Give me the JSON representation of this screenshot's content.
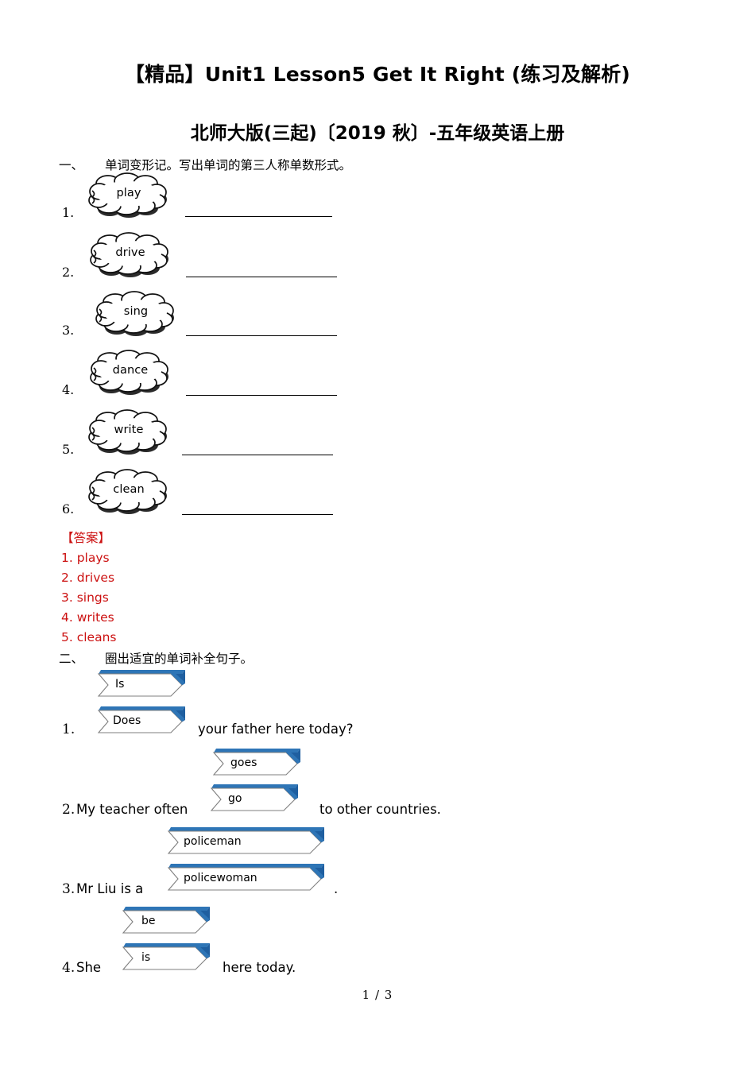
{
  "document": {
    "title_main": "【精品】Unit1 Lesson5 Get It Right (练习及解析)",
    "title_sub": "北师大版(三起)〔2019 秋〕-五年级英语上册",
    "footer": "1 / 3"
  },
  "colors": {
    "answer_red": "#CC1111",
    "chevron_blue": "#2E75B6",
    "chevron_outline": "#7F7F7F",
    "text_black": "#000000"
  },
  "section_one": {
    "marker": "一、",
    "heading": "单词变形记。写出单词的第三人称单数形式。",
    "items": [
      {
        "number": "1.",
        "word": "play",
        "blank": ""
      },
      {
        "number": "2.",
        "word": "drive",
        "blank": ""
      },
      {
        "number": "3.",
        "word": "sing",
        "blank": ""
      },
      {
        "number": "4.",
        "word": "dance",
        "blank": ""
      },
      {
        "number": "5.",
        "word": "write",
        "blank": ""
      },
      {
        "number": "6.",
        "word": "clean",
        "blank": ""
      }
    ]
  },
  "answer_block": {
    "label": "【答案】",
    "lines": [
      "1. plays",
      "2. drives",
      "3. sings",
      "4. writes",
      "5. cleans"
    ]
  },
  "section_two": {
    "marker": "二、",
    "heading": "圈出适宜的单词补全句子。",
    "questions": [
      {
        "number": "1.",
        "options": [
          "Is",
          "Does"
        ],
        "text_before": "",
        "text_after": "your father here today?"
      },
      {
        "number": "2.",
        "options": [
          "goes",
          "go"
        ],
        "text_before": "My teacher often",
        "text_after": "to other countries."
      },
      {
        "number": "3.",
        "options": [
          "policeman",
          "policewoman"
        ],
        "text_before": "Mr Liu is a",
        "text_after": "."
      },
      {
        "number": "4.",
        "options": [
          "be",
          "is"
        ],
        "text_before": "She",
        "text_after": "here today."
      }
    ]
  }
}
